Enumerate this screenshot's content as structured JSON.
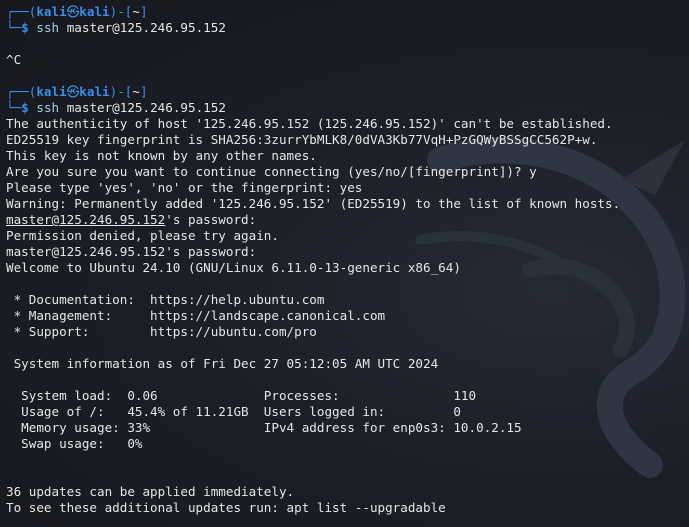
{
  "prompt1": {
    "top_open": "┌──(",
    "user": "kali",
    "skull": "㉿",
    "host": "kali",
    "close": ")-[",
    "cwd": "~",
    "end": "]",
    "bottom": "└─",
    "dollar": "$",
    "command": "ssh",
    "arg": " master@125.246.95.152"
  },
  "interrupt": "^C",
  "prompt2": {
    "top_open": "┌──(",
    "user": "kali",
    "skull": "㉿",
    "host": "kali",
    "close": ")-[",
    "cwd": "~",
    "end": "]",
    "bottom": "└─",
    "dollar": "$",
    "command": "ssh",
    "arg": " master@125.246.95.152"
  },
  "output": {
    "auth": "The authenticity of host '125.246.95.152 (125.246.95.152)' can't be established.",
    "fingerprint": "ED25519 key fingerprint is SHA256:3zurrYbMLK8/0dVA3Kb77VqH+PzGQWyBSSgCC562P+w.",
    "not_known": "This key is not known by any other names.",
    "continue": "Are you sure you want to continue connecting (yes/no/[fingerprint])? y",
    "type_yes": "Please type 'yes', 'no' or the fingerprint: yes",
    "warning": "Warning: Permanently added '125.246.95.152' (ED25519) to the list of known hosts.",
    "pw_prompt1_host": "master@125.246.95.152",
    "pw_prompt1_rest": "'s password:",
    "denied": "Permission denied, please try again.",
    "pw_prompt2": "master@125.246.95.152's password:",
    "welcome": "Welcome to Ubuntu 24.10 (GNU/Linux 6.11.0-13-generic x86_64)",
    "doc": " * Documentation:  https://help.ubuntu.com",
    "mgmt": " * Management:     https://landscape.canonical.com",
    "support": " * Support:        https://ubuntu.com/pro",
    "sysinfo": " System information as of Fri Dec 27 05:12:05 AM UTC 2024",
    "row1": "  System load:  0.06              Processes:               110",
    "row2": "  Usage of /:   45.4% of 11.21GB  Users logged in:         0",
    "row3": "  Memory usage: 33%               IPv4 address for enp0s3: 10.0.2.15",
    "row4": "  Swap usage:   0%",
    "updates": "36 updates can be applied immediately.",
    "updates_cmd": "To see these additional updates run: apt list --upgradable"
  },
  "colors": {
    "background": "#1c1f27",
    "prompt_blue": "#3b8eea",
    "text": "#e6e6e6"
  }
}
